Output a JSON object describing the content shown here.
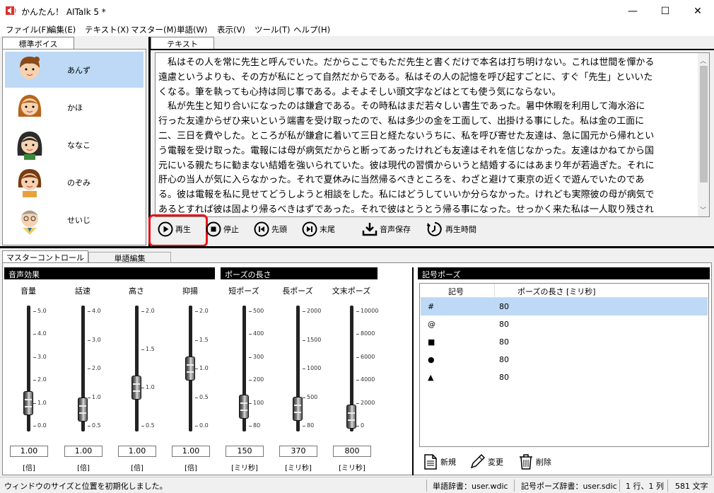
{
  "window": {
    "title": "かんたん！ AITalk 5 *",
    "minimize": "—",
    "maximize": "☐",
    "close": "✕"
  },
  "menu": [
    "ファイル(F)",
    "編集(E)",
    "テキスト(X)",
    "マスター(M)",
    "単語(W)",
    "表示(V)",
    "ツール(T)",
    "ヘルプ(H)"
  ],
  "voice_panel": {
    "tab": "標準ボイス",
    "voices": [
      {
        "name": "あんず",
        "selected": true
      },
      {
        "name": "かほ",
        "selected": false
      },
      {
        "name": "ななこ",
        "selected": false
      },
      {
        "name": "のぞみ",
        "selected": false
      },
      {
        "name": "せいじ",
        "selected": false
      }
    ]
  },
  "text_panel": {
    "tab": "テキスト",
    "lines": [
      "　私はその人を常に先生と呼んでいた。だからここでもただ先生と書くだけで本名は打ち明けない。これは世間を憚かる",
      "遠慮というよりも、その方が私にとって自然だからである。私はその人の記憶を呼び起すごとに、すぐ「先生」といいた",
      "くなる。筆を執っても心持は同じ事である。よそよそしい頭文字などはとても使う気にならない。",
      "　私が先生と知り合いになったのは鎌倉である。その時私はまだ若々しい書生であった。暑中休暇を利用して海水浴に",
      "行った友達からぜひ来いという端書を受け取ったので、私は多少の金を工面して、出掛ける事にした。私は金の工面に",
      "二、三日を費やした。ところが私が鎌倉に着いて三日と経たないうちに、私を呼び寄せた友達は、急に国元から帰れとい",
      "う電報を受け取った。電報には母が病気だからと断ってあったけれども友達はそれを信じなかった。友達はかねてから国",
      "元にいる親たちに勧まない結婚を強いられていた。彼は現代の習慣からいうと結婚するにはあまり年が若過ぎた。それに",
      "肝心の当人が気に入らなかった。それで夏休みに当然帰るべきところを、わざと避けて東京の近くで遊んでいたのであ",
      "る。彼は電報を私に見せてどうしようと相談をした。私にはどうしていいか分らなかった。けれども実際彼の母が病気で",
      "あるとすれば彼は固より帰るべきはずであった。それで彼はとうとう帰る事になった。せっかく来た私は一人取り残され"
    ],
    "controls": {
      "play": "再生",
      "stop": "停止",
      "head": "先頭",
      "tail": "末尾",
      "save": "音声保存",
      "time": "再生時間"
    }
  },
  "master": {
    "tabs": [
      "マスターコントロール",
      "単語編集"
    ],
    "effect_header": "音声効果",
    "pause_header": "ポーズの長さ",
    "symbol_header": "記号ポーズ",
    "sliders": [
      {
        "label": "音量",
        "value": "1.00",
        "unit": "[倍]",
        "ticks": [
          "5.0",
          "4.0",
          "3.0",
          "2.0",
          "1.0",
          "0.0"
        ],
        "min": 0,
        "max": 5,
        "level": 1.0
      },
      {
        "label": "話速",
        "value": "1.00",
        "unit": "[倍]",
        "ticks": [
          "4.0",
          "3.0",
          "2.0",
          "1.0",
          "0.5"
        ],
        "min": 0.5,
        "max": 4,
        "level": 1.0
      },
      {
        "label": "高さ",
        "value": "1.00",
        "unit": "[倍]",
        "ticks": [
          "2.0",
          "1.5",
          "1.0",
          "0.5"
        ],
        "min": 0.5,
        "max": 2,
        "level": 1.0
      },
      {
        "label": "抑揚",
        "value": "1.00",
        "unit": "[倍]",
        "ticks": [
          "2.0",
          "1.5",
          "1.0",
          "0.5",
          "0.0"
        ],
        "min": 0,
        "max": 2,
        "level": 1.0
      },
      {
        "label": "短ポーズ",
        "value": "150",
        "unit": "[ミリ秒]",
        "ticks": [
          "500",
          "400",
          "300",
          "200",
          "100",
          "80"
        ],
        "min": 80,
        "max": 500,
        "level": 150
      },
      {
        "label": "長ポーズ",
        "value": "370",
        "unit": "[ミリ秒]",
        "ticks": [
          "2000",
          "1500",
          "1000",
          "500",
          "80"
        ],
        "min": 80,
        "max": 2000,
        "level": 370
      },
      {
        "label": "文末ポーズ",
        "value": "800",
        "unit": "[ミリ秒]",
        "ticks": [
          "10000",
          "8000",
          "6000",
          "4000",
          "2000",
          "0"
        ],
        "min": 0,
        "max": 10000,
        "level": 800
      }
    ],
    "symbol_table": {
      "columns": [
        "記号",
        "ポーズの長さ [ミリ秒]"
      ],
      "rows": [
        {
          "symbol": "#",
          "value": "80",
          "selected": true
        },
        {
          "symbol": "@",
          "value": "80",
          "selected": false
        },
        {
          "symbol": "■",
          "value": "80",
          "selected": false
        },
        {
          "symbol": "●",
          "value": "80",
          "selected": false
        },
        {
          "symbol": "▲",
          "value": "80",
          "selected": false
        }
      ],
      "buttons": {
        "new": "新規",
        "edit": "変更",
        "delete": "削除"
      }
    }
  },
  "status": {
    "message": "ウィンドウのサイズと位置を初期化しました。",
    "word_dict": "単語辞書：user.wdic",
    "symbol_dict": "記号ポーズ辞書：user.sdic",
    "position": "1 行、1 列",
    "count": "581 文字"
  },
  "colors": {
    "selection": "#bdd9f6",
    "highlight_box": "#e8141c",
    "header_bg": "#000000"
  }
}
